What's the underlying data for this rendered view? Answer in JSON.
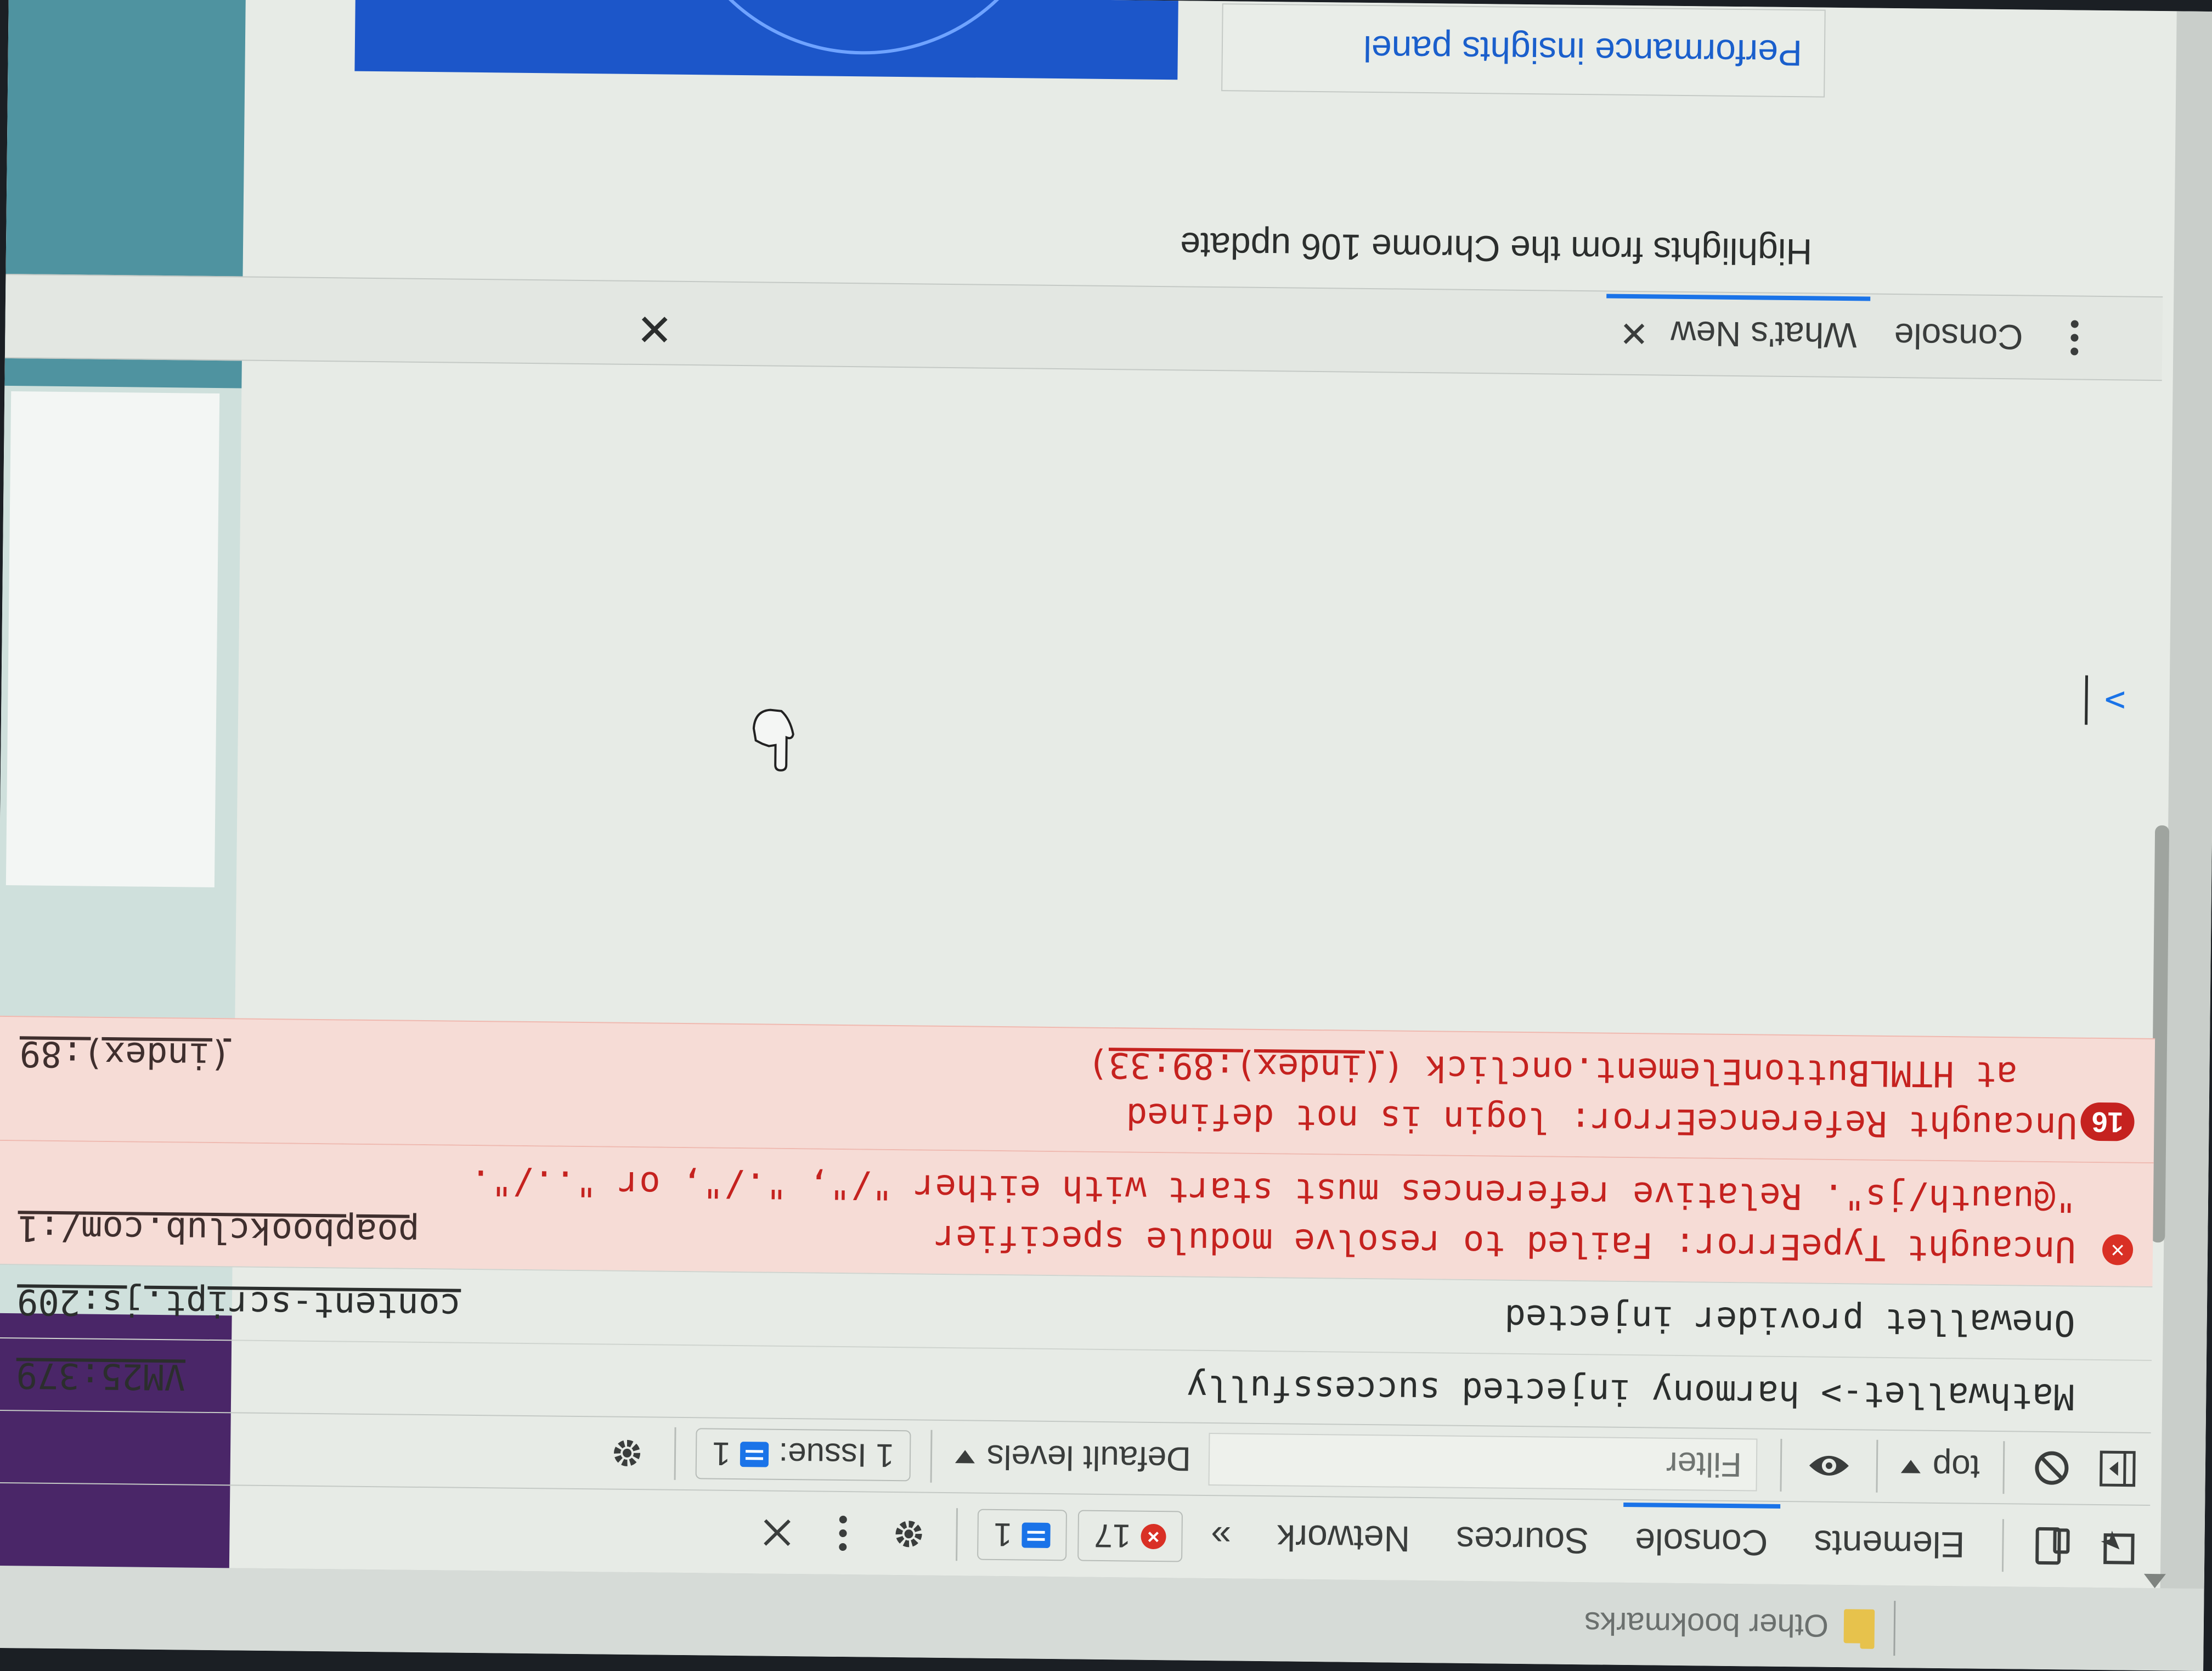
{
  "bookmarks": {
    "other_label": "Other bookmarks"
  },
  "main_tabs": [
    {
      "label": "Elements"
    },
    {
      "label": "Console"
    },
    {
      "label": "Sources"
    },
    {
      "label": "Network"
    }
  ],
  "main_tabs_more": "»",
  "header_badges": {
    "errors": "17",
    "messages": "1"
  },
  "toolbar": {
    "context": "top",
    "filter_placeholder": "Filter",
    "levels": "Default levels",
    "issues_label": "1 Issue:",
    "issues_count": "1"
  },
  "logs": [
    {
      "type": "info",
      "text": "Mathwallet-> harmony injected successfully",
      "source": "VM25:379"
    },
    {
      "type": "info",
      "text": "Onewallet provider injected",
      "source": "content-script.js:209"
    },
    {
      "type": "error",
      "text": "Uncaught TypeError: Failed to resolve module specifier",
      "text2": "\"@uauth/js\". Relative references must start with either \"/\", \"./\", or \"../\".",
      "source": "poapbookclub.com/:1"
    },
    {
      "type": "error",
      "count": "16",
      "text": "Uncaught ReferenceError: login is not defined",
      "text2": "at HTMLButtonElement.onclick (",
      "link2": "(index):89:33",
      "text2_end": ")",
      "source": "(index):89"
    }
  ],
  "prompt": ">",
  "drawer": {
    "tabs": [
      {
        "label": "Console"
      },
      {
        "label": "What's New"
      }
    ],
    "heading": "Highlights from the Chrome 106 update",
    "card": "Performance insights panel"
  },
  "colors": {
    "accent": "#1a73e8",
    "error": "#c5221f",
    "error_bg": "#f6dcd6"
  }
}
